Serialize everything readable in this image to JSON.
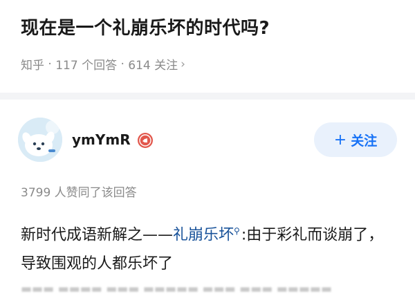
{
  "question": {
    "title": "现在是一个礼崩乐坏的时代吗?",
    "source": "知乎",
    "answers": "117 个回答",
    "followers": "614 关注"
  },
  "author": {
    "name": "ymYmR",
    "follow_label": "关注"
  },
  "answer": {
    "likes": "3799 人赞同了该回答",
    "text_before": "新时代成语新解之——",
    "keyword": "礼崩乐坏",
    "text_after": ":由于彩礼而谈崩了，导致围观的人都乐坏了"
  },
  "colors": {
    "accent": "#1772f6",
    "link": "#175199",
    "badge": "#e2574c"
  }
}
